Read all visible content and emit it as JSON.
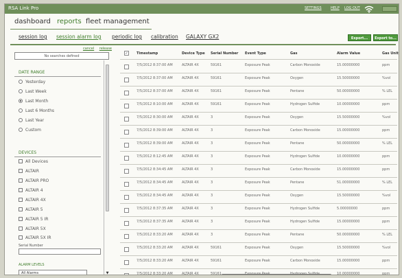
{
  "app": {
    "title": "RSA Link Pro"
  },
  "title_links": [
    "SETTINGS",
    "HELP",
    "LOG OUT"
  ],
  "nav": {
    "items": [
      "dashboard",
      "reports",
      "fleet management"
    ]
  },
  "subnav": {
    "items": [
      "session log",
      "session alarm log",
      "periodic log",
      "calibration",
      "GALAXY GX2"
    ]
  },
  "export": {
    "buttons": [
      "Export...",
      "Export to..."
    ]
  },
  "sidebar": {
    "links": [
      "cancel",
      "release"
    ],
    "filter_text": "No searches defined",
    "date_range": {
      "heading": "Date Range",
      "options": [
        "Yesterday",
        "Last Week",
        "Last Month",
        "Last 6 Months",
        "Last Year",
        "Custom"
      ],
      "selected": "Last Month"
    },
    "devices": {
      "heading": "Devices",
      "items": [
        "All Devices",
        "ALTAIR",
        "ALTAIR PRO",
        "ALTAIR 4",
        "ALTAIR 4X",
        "ALTAIR 5",
        "ALTAIR 5 IR",
        "ALTAIR 5X",
        "ALTAIR 5X IR"
      ],
      "serial_label": "Serial Number"
    },
    "alarm_levels": {
      "heading": "Alarm Levels",
      "selected": "All Alarms"
    }
  },
  "table": {
    "columns": [
      "Timestamp",
      "Device Type",
      "Serial Number",
      "Event Type",
      "Gas",
      "Alarm Value",
      "Gas Unit"
    ],
    "rows": [
      [
        "7/5/2012 8:37:00 AM",
        "ALTAIR 4X",
        "59161",
        "Exposure Peak",
        "Carbon Monoxide",
        "15.00000000",
        "ppm"
      ],
      [
        "7/5/2012 8:37:00 AM",
        "ALTAIR 4X",
        "59161",
        "Exposure Peak",
        "Oxygen",
        "15.50000000",
        "%vol"
      ],
      [
        "7/5/2012 8:37:00 AM",
        "ALTAIR 4X",
        "59161",
        "Exposure Peak",
        "Pentane",
        "50.00000000",
        "% LEL"
      ],
      [
        "7/5/2012 8:10:00 AM",
        "ALTAIR 4X",
        "59161",
        "Exposure Peak",
        "Hydrogen Sulfide",
        "10.00000000",
        "ppm"
      ],
      [
        "7/5/2012 8:30:00 AM",
        "ALTAIR 4X",
        "3",
        "Exposure Peak",
        "Oxygen",
        "15.50000000",
        "%vol"
      ],
      [
        "7/5/2012 8:39:00 AM",
        "ALTAIR 4X",
        "3",
        "Exposure Peak",
        "Carbon Monoxide",
        "15.00000000",
        "ppm"
      ],
      [
        "7/5/2012 8:39:00 AM",
        "ALTAIR 4X",
        "3",
        "Exposure Peak",
        "Pentane",
        "50.00000000",
        "% LEL"
      ],
      [
        "7/5/2012 8:12:45 AM",
        "ALTAIR 4X",
        "3",
        "Exposure Peak",
        "Hydrogen Sulfide",
        "10.00000000",
        "ppm"
      ],
      [
        "7/5/2012 8:34:45 AM",
        "ALTAIR 4X",
        "3",
        "Exposure Peak",
        "Carbon Monoxide",
        "15.00000000",
        "ppm"
      ],
      [
        "7/5/2012 8:34:45 AM",
        "ALTAIR 4X",
        "3",
        "Exposure Peak",
        "Pentane",
        "51.00000000",
        "% LEL"
      ],
      [
        "7/5/2012 8:34:45 AM",
        "ALTAIR 4X",
        "3",
        "Exposure Peak",
        "Oxygen",
        "15.50000000",
        "%vol"
      ],
      [
        "7/5/2012 8:37:35 AM",
        "ALTAIR 4X",
        "3",
        "Exposure Peak",
        "Hydrogen Sulfide",
        "5.00000000",
        "ppm"
      ],
      [
        "7/5/2012 8:37:35 AM",
        "ALTAIR 4X",
        "3",
        "Exposure Peak",
        "Hydrogen Sulfide",
        "15.00000000",
        "ppm"
      ],
      [
        "7/5/2012 8:33:20 AM",
        "ALTAIR 4X",
        "3",
        "Exposure Peak",
        "Pentane",
        "50.00000000",
        "% LEL"
      ],
      [
        "7/5/2012 8:33:20 AM",
        "ALTAIR 4X",
        "59161",
        "Exposure Peak",
        "Oxygen",
        "15.50000000",
        "%vol"
      ],
      [
        "7/5/2012 8:33:20 AM",
        "ALTAIR 4X",
        "59161",
        "Exposure Peak",
        "Carbon Monoxide",
        "15.00000000",
        "ppm"
      ],
      [
        "7/5/2012 8:33:20 AM",
        "ALTAIR 4X",
        "59161",
        "Exposure Peak",
        "Hydrogen Sulfide",
        "10.00000000",
        "ppm"
      ]
    ]
  },
  "colors": {
    "accent": "#3f7d2b",
    "titlebar": "#6f8f5a",
    "export": "#4f9a3d"
  }
}
